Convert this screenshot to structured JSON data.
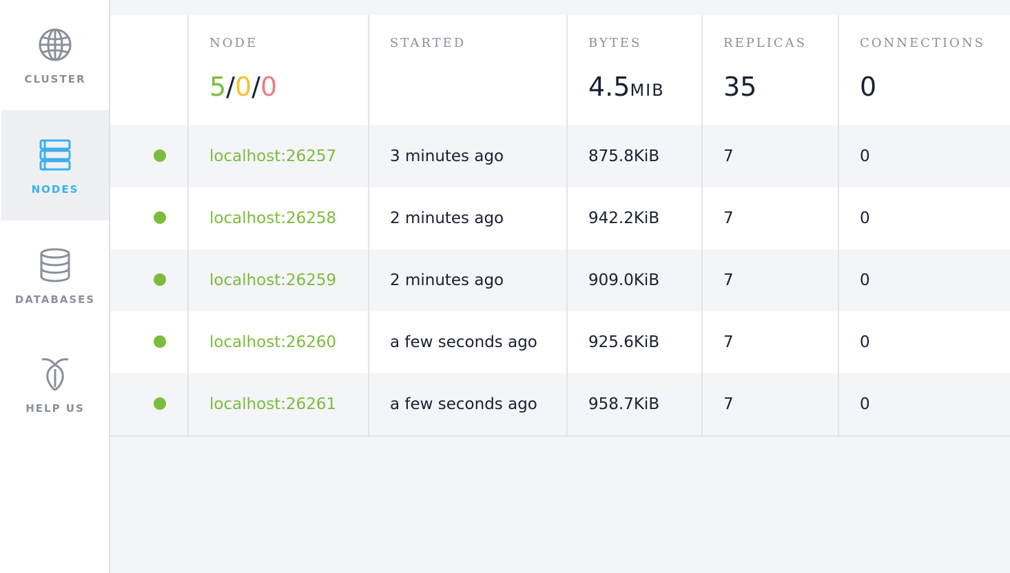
{
  "sidebar": {
    "items": [
      {
        "label": "CLUSTER",
        "icon": "globe-icon",
        "active": false
      },
      {
        "label": "NODES",
        "icon": "nodes-list-icon",
        "active": true
      },
      {
        "label": "DATABASES",
        "icon": "database-icon",
        "active": false
      },
      {
        "label": "HELP US",
        "icon": "cockroach-icon",
        "active": false
      }
    ]
  },
  "header": {
    "node_label": "NODE",
    "node_live": "5",
    "node_sep1": "/",
    "node_suspect": "0",
    "node_sep2": "/",
    "node_dead": "0",
    "started_label": "STARTED",
    "bytes_label": "BYTES",
    "bytes_value": "4.5",
    "bytes_unit": "MIB",
    "replicas_label": "REPLICAS",
    "replicas_value": "35",
    "connections_label": "CONNECTIONS",
    "connections_value": "0"
  },
  "rows": [
    {
      "node": "localhost:26257",
      "started": "3 minutes ago",
      "bytes": "875.8KiB",
      "replicas": "7",
      "connections": "0",
      "status": "live"
    },
    {
      "node": "localhost:26258",
      "started": "2 minutes ago",
      "bytes": "942.2KiB",
      "replicas": "7",
      "connections": "0",
      "status": "live"
    },
    {
      "node": "localhost:26259",
      "started": "2 minutes ago",
      "bytes": "909.0KiB",
      "replicas": "7",
      "connections": "0",
      "status": "live"
    },
    {
      "node": "localhost:26260",
      "started": "a few seconds ago",
      "bytes": "925.6KiB",
      "replicas": "7",
      "connections": "0",
      "status": "live"
    },
    {
      "node": "localhost:26261",
      "started": "a few seconds ago",
      "bytes": "958.7KiB",
      "replicas": "7",
      "connections": "0",
      "status": "live"
    }
  ],
  "colors": {
    "live": "#7cbc3c",
    "suspect": "#f5c12f",
    "dead": "#ea7c88",
    "accent": "#3ab0ee"
  }
}
